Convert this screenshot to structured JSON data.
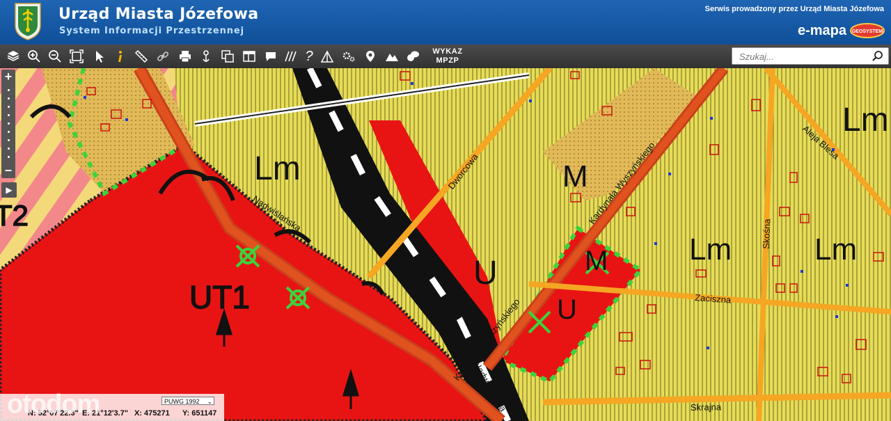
{
  "header": {
    "title": "Urząd Miasta Józefowa",
    "subtitle": "System Informacji Przestrzennej",
    "provider": "Serwis prowadzony przez Urząd Miasta Józefowa",
    "emapa": "e-mapa",
    "geo_logo": "GEOSYSTEM"
  },
  "toolbar": {
    "tools": [
      "layers-icon",
      "zoom-in-icon",
      "zoom-out-icon",
      "zoom-extent-icon",
      "pointer-icon",
      "info-icon",
      "measure-icon",
      "link-icon",
      "print-icon",
      "pan-icon",
      "copy-icon",
      "layout-icon",
      "comment-icon",
      "hatch-icon",
      "help-icon",
      "profile-icon",
      "settings-icon",
      "marker-icon",
      "terrain-icon",
      "chat-icon"
    ],
    "wykaz_line1": "WYKAZ",
    "wykaz_line2": "MPZP",
    "search_placeholder": "Szukaj..."
  },
  "map": {
    "zone_labels": [
      "UT1",
      "T2",
      "Lm",
      "Lm",
      "Lm",
      "Lm",
      "M",
      "U",
      "U",
      "M"
    ],
    "streets": [
      "Nadwiślańska",
      "Nadwiślańska",
      "Dworcowa",
      "Kardynała Wyszyńskiego",
      "Kardynała Wyszyńskiego",
      "Aleja Blesa",
      "Skośna",
      "Zaciszna",
      "Skrajna"
    ],
    "coord_system": "PUWG 1992",
    "coords": {
      "n": "N: 52°07'22.3\"",
      "e": "E: 21°12'3.7\"",
      "x": "X: 475271",
      "y": "Y: 651147"
    },
    "watermark": "otodom",
    "colors": {
      "residential": "#e9e050",
      "forest_hatch": "#f3e36a",
      "tourism_red": "#e81414",
      "road_orange": "#f5a623",
      "rail_black": "#111111",
      "building_outline": "#cc1111"
    }
  }
}
